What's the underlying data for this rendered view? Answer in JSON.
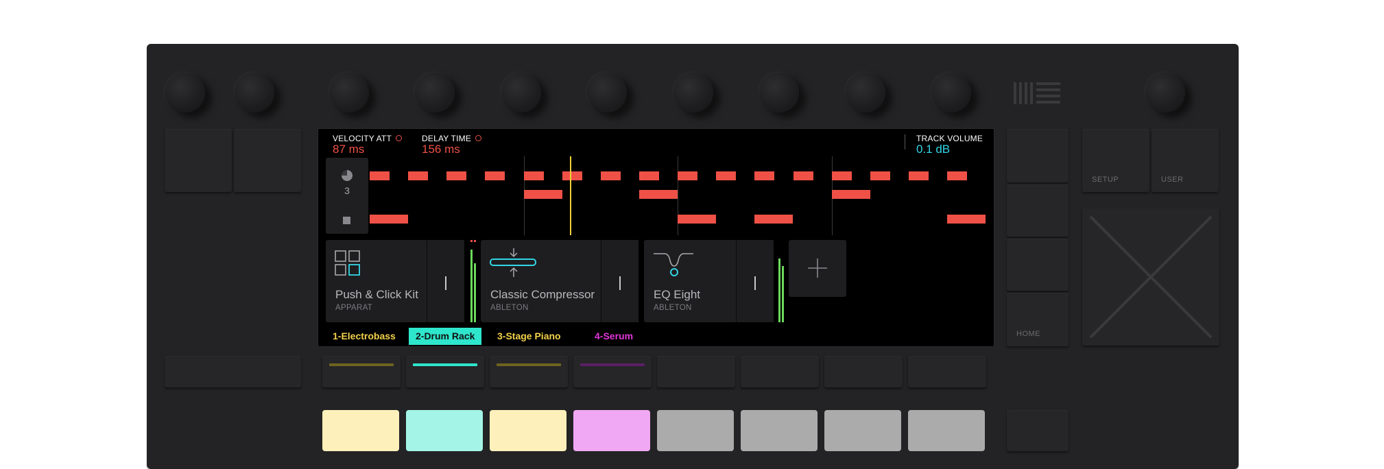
{
  "screen": {
    "params": [
      {
        "label": "VELOCITY ATT",
        "value": "87 ms",
        "color": "#ef5147"
      },
      {
        "label": "DELAY TIME",
        "value": "156 ms",
        "color": "#ef5147"
      },
      {
        "label": "TRACK VOLUME",
        "value": "0.1 dB",
        "color": "#32d6e6"
      }
    ],
    "lane_control": {
      "number": "3"
    },
    "devices": [
      {
        "name": "Push & Click Kit",
        "maker": "APPARAT"
      },
      {
        "name": "Classic Compressor",
        "maker": "ABLETON"
      },
      {
        "name": "EQ Eight",
        "maker": "ABLETON"
      }
    ],
    "tracks": [
      {
        "label": "1-Electrobass",
        "color": "#f2d24a",
        "selected": false
      },
      {
        "label": "2-Drum Rack",
        "color": "#2ee6cc",
        "selected": true
      },
      {
        "label": "3-Stage Piano",
        "color": "#f2d24a",
        "selected": false
      },
      {
        "label": "4-Serum",
        "color": "#e236dc",
        "selected": false
      }
    ]
  },
  "buttons": {
    "setup": "SETUP",
    "user": "USER",
    "home": "HOME"
  },
  "lower_row_colors": [
    "#6e6320",
    "#2ee6cc",
    "#6e6320",
    "#5b1f66",
    "",
    "",
    "",
    ""
  ],
  "pad_colors": [
    "#fdf0bb",
    "#a4f5e7",
    "#fdf0bb",
    "#f1a8f4",
    "#ababab",
    "#ababab",
    "#ababab",
    "#ababab"
  ],
  "colors": {
    "accent_red": "#ef5147",
    "accent_cyan": "#32d6e6",
    "playhead": "#f0d33a",
    "meter": "#6cd95c"
  }
}
